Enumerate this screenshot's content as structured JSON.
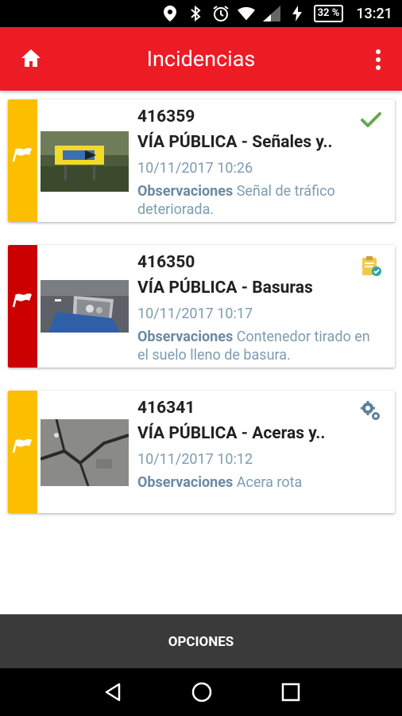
{
  "status_bar": {
    "battery": "32 %",
    "time": "13:21",
    "icons": [
      "location-icon",
      "bluetooth-icon",
      "alarm-icon",
      "wifi-icon",
      "signal-icon",
      "charging-icon"
    ]
  },
  "app_bar": {
    "title": "Incidencias",
    "home_icon": "home-icon",
    "menu_icon": "more-vert-icon",
    "color": "#ed1c24"
  },
  "incidents": [
    {
      "id": "416359",
      "category": "VÍA PÚBLICA - Señales y..",
      "date": "10/11/2017 10:26",
      "obs_label": "Observaciones",
      "obs_text": "Señal de tráfico deteriorada.",
      "priority_color": "#fbbf00",
      "status_icon": "check-icon"
    },
    {
      "id": "416350",
      "category": "VÍA PÚBLICA - Basuras",
      "date": "10/11/2017 10:17",
      "obs_label": "Observaciones",
      "obs_text": "Contenedor tirado en el suelo lleno de basura.",
      "priority_color": "#cc0000",
      "status_icon": "clipboard-check-icon"
    },
    {
      "id": "416341",
      "category": "VÍA PÚBLICA - Aceras y..",
      "date": "10/11/2017 10:12",
      "obs_label": "Observaciones",
      "obs_text": "Acera rota",
      "priority_color": "#fbbf00",
      "status_icon": "gears-icon"
    }
  ],
  "bottom_bar": {
    "label": "OPCIONES"
  },
  "nav_bar": {
    "icons": [
      "back-icon",
      "home-circle-icon",
      "recents-icon"
    ]
  }
}
